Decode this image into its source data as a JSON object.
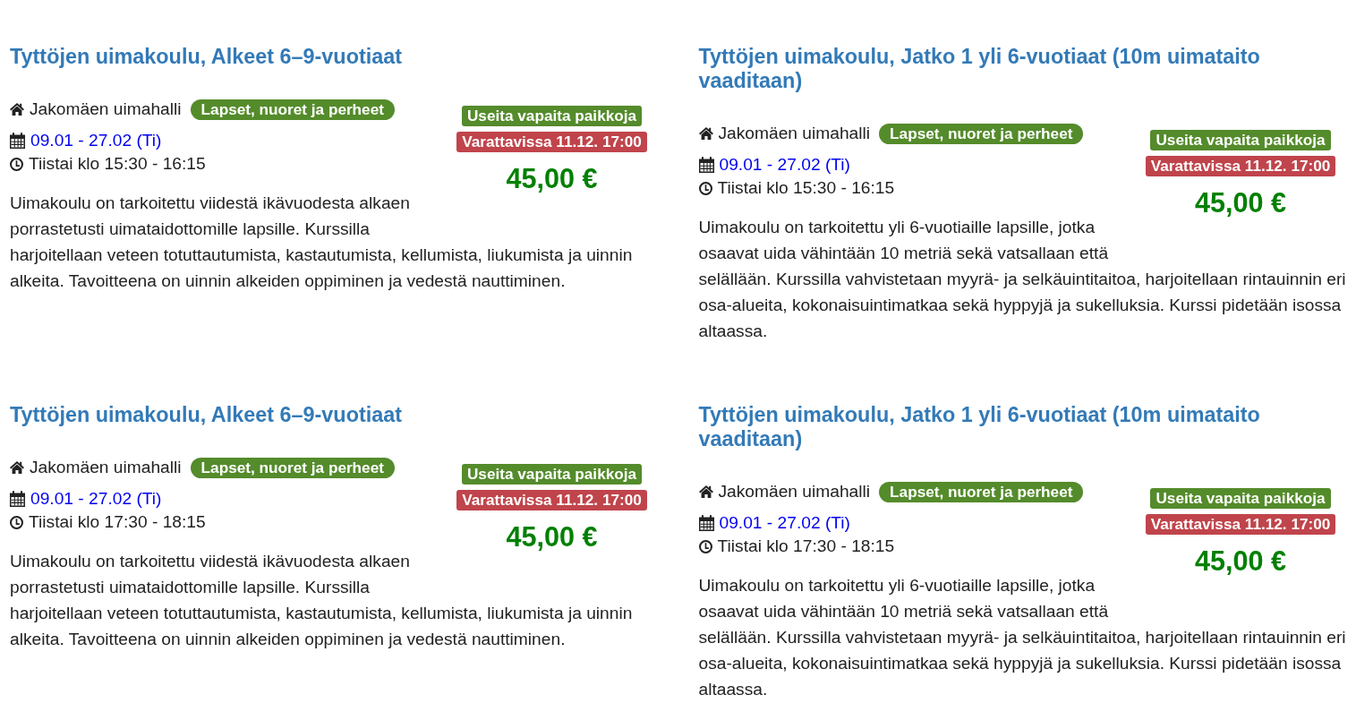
{
  "courses": [
    {
      "title": "Tyttöjen uimakoulu, Alkeet 6–9-vuotiaat",
      "location": "Jakomäen uimahalli",
      "category_badge": "Lapset, nuoret ja perheet",
      "date_range": "09.01 - 27.02 (Ti)",
      "schedule": "Tiistai klo 15:30 - 16:15",
      "availability_badge": "Useita vapaita paikkoja",
      "booking_badge": "Varattavissa 11.12. 17:00",
      "price": "45,00 €",
      "description": "Uimakoulu on tarkoitettu viidestä ikävuodesta alkaen porrastetusti uimataidottomille lapsille. Kurssilla harjoitellaan veteen totuttautumista, kastautumista, kellumista, liukumista ja uinnin alkeita. Tavoitteena on uinnin alkeiden oppiminen ja vedestä nauttiminen."
    },
    {
      "title": "Tyttöjen uimakoulu, Jatko 1 yli 6-vuotiaat (10m uimataito vaaditaan)",
      "location": "Jakomäen uimahalli",
      "category_badge": "Lapset, nuoret ja perheet",
      "date_range": "09.01 - 27.02 (Ti)",
      "schedule": "Tiistai klo 15:30 - 16:15",
      "availability_badge": "Useita vapaita paikkoja",
      "booking_badge": "Varattavissa 11.12. 17:00",
      "price": "45,00 €",
      "description": "Uimakoulu on tarkoitettu yli 6-vuotiaille lapsille, jotka osaavat uida vähintään 10 metriä sekä vatsallaan että selällään. Kurssilla vahvistetaan myyrä- ja selkäuintitaitoa, harjoitellaan rintauinnin eri osa-alueita, kokonaisuintimatkaa sekä hyppyjä ja sukelluksia. Kurssi pidetään isossa altaassa."
    },
    {
      "title": "Tyttöjen uimakoulu, Alkeet 6–9-vuotiaat",
      "location": "Jakomäen uimahalli",
      "category_badge": "Lapset, nuoret ja perheet",
      "date_range": "09.01 - 27.02 (Ti)",
      "schedule": "Tiistai klo 17:30 - 18:15",
      "availability_badge": "Useita vapaita paikkoja",
      "booking_badge": "Varattavissa 11.12. 17:00",
      "price": "45,00 €",
      "description": "Uimakoulu on tarkoitettu viidestä ikävuodesta alkaen porrastetusti uimataidottomille lapsille. Kurssilla harjoitellaan veteen totuttautumista, kastautumista, kellumista, liukumista ja uinnin alkeita. Tavoitteena on uinnin alkeiden oppiminen ja vedestä nauttiminen."
    },
    {
      "title": "Tyttöjen uimakoulu, Jatko 1 yli 6-vuotiaat (10m uimataito vaaditaan)",
      "location": "Jakomäen uimahalli",
      "category_badge": "Lapset, nuoret ja perheet",
      "date_range": "09.01 - 27.02 (Ti)",
      "schedule": "Tiistai klo 17:30 - 18:15",
      "availability_badge": "Useita vapaita paikkoja",
      "booking_badge": "Varattavissa 11.12. 17:00",
      "price": "45,00 €",
      "description": "Uimakoulu on tarkoitettu yli 6-vuotiaille lapsille, jotka osaavat uida vähintään 10 metriä sekä vatsallaan että selällään. Kurssilla vahvistetaan myyrä- ja selkäuintitaitoa, harjoitellaan rintauinnin eri osa-alueita, kokonaisuintimatkaa sekä hyppyjä ja sukelluksia. Kurssi pidetään isossa altaassa."
    }
  ]
}
